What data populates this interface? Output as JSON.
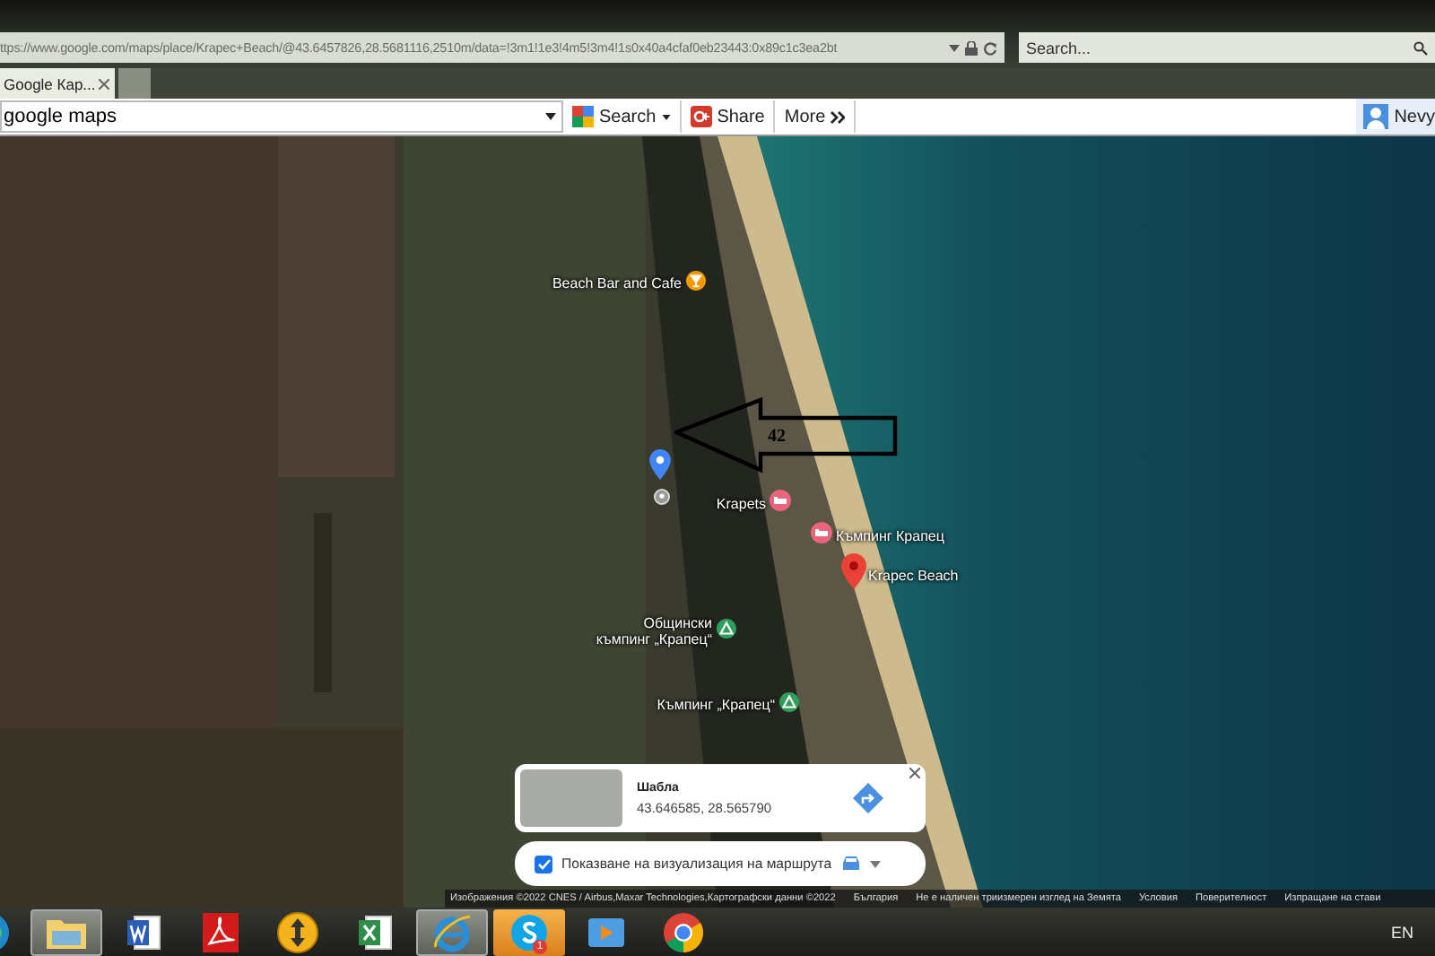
{
  "browser": {
    "address": "ttps://www.google.com/maps/place/Krapec+Beach/@43.6457826,28.5681116,2510m/data=!3m1!1e3!4m5!3m4!1s0x40a4cfaf0eb23443:0x89c1c3ea2bt",
    "search_placeholder": "Search..."
  },
  "tabs": [
    {
      "label": "Google Кар...",
      "selected": true
    }
  ],
  "toolbar": {
    "query": "google maps",
    "search_button": "Search",
    "share_button": "Share",
    "more_button": "More",
    "user": "Nevy"
  },
  "map": {
    "places": [
      {
        "name": "Beach Bar and Cafe",
        "kind": "cafe"
      },
      {
        "name": "Krapets",
        "kind": "lodging"
      },
      {
        "name": "Къмпинг Крапец",
        "kind": "lodging"
      },
      {
        "name": "Krapec Beach",
        "kind": "selected"
      },
      {
        "name": "Общински\nкъмпинг „Крапец“",
        "kind": "camping"
      },
      {
        "name": "Къмпинг „Крапец“",
        "kind": "camping"
      }
    ],
    "annotation": {
      "label": "42"
    },
    "info_card": {
      "title": "Шабла",
      "coordinates": "43.646585, 28.565790"
    },
    "route_toggle": {
      "label": "Показване на визуализация на маршрута",
      "checked": true
    },
    "attribution": [
      "Изображения ©2022 CNES / Airbus,Maxar Technologies,Картографски данни ©2022",
      "България",
      "Не е наличен триизмерен изглед на Земята",
      "Условия",
      "Поверителност",
      "Изпращане на стави"
    ]
  },
  "taskbar": {
    "apps": [
      {
        "kind": "edge",
        "running": false,
        "alert": false
      },
      {
        "kind": "folder",
        "running": true,
        "alert": false
      },
      {
        "kind": "word",
        "running": false,
        "alert": false
      },
      {
        "kind": "pdf",
        "running": false,
        "alert": false
      },
      {
        "kind": "updown",
        "running": false,
        "alert": false
      },
      {
        "kind": "excel",
        "running": false,
        "alert": false
      },
      {
        "kind": "ie",
        "running": true,
        "alert": false
      },
      {
        "kind": "skype",
        "running": false,
        "alert": true,
        "badge": "1"
      },
      {
        "kind": "media",
        "running": false,
        "alert": false
      },
      {
        "kind": "chrome",
        "running": false,
        "alert": false
      }
    ],
    "language": "EN"
  }
}
